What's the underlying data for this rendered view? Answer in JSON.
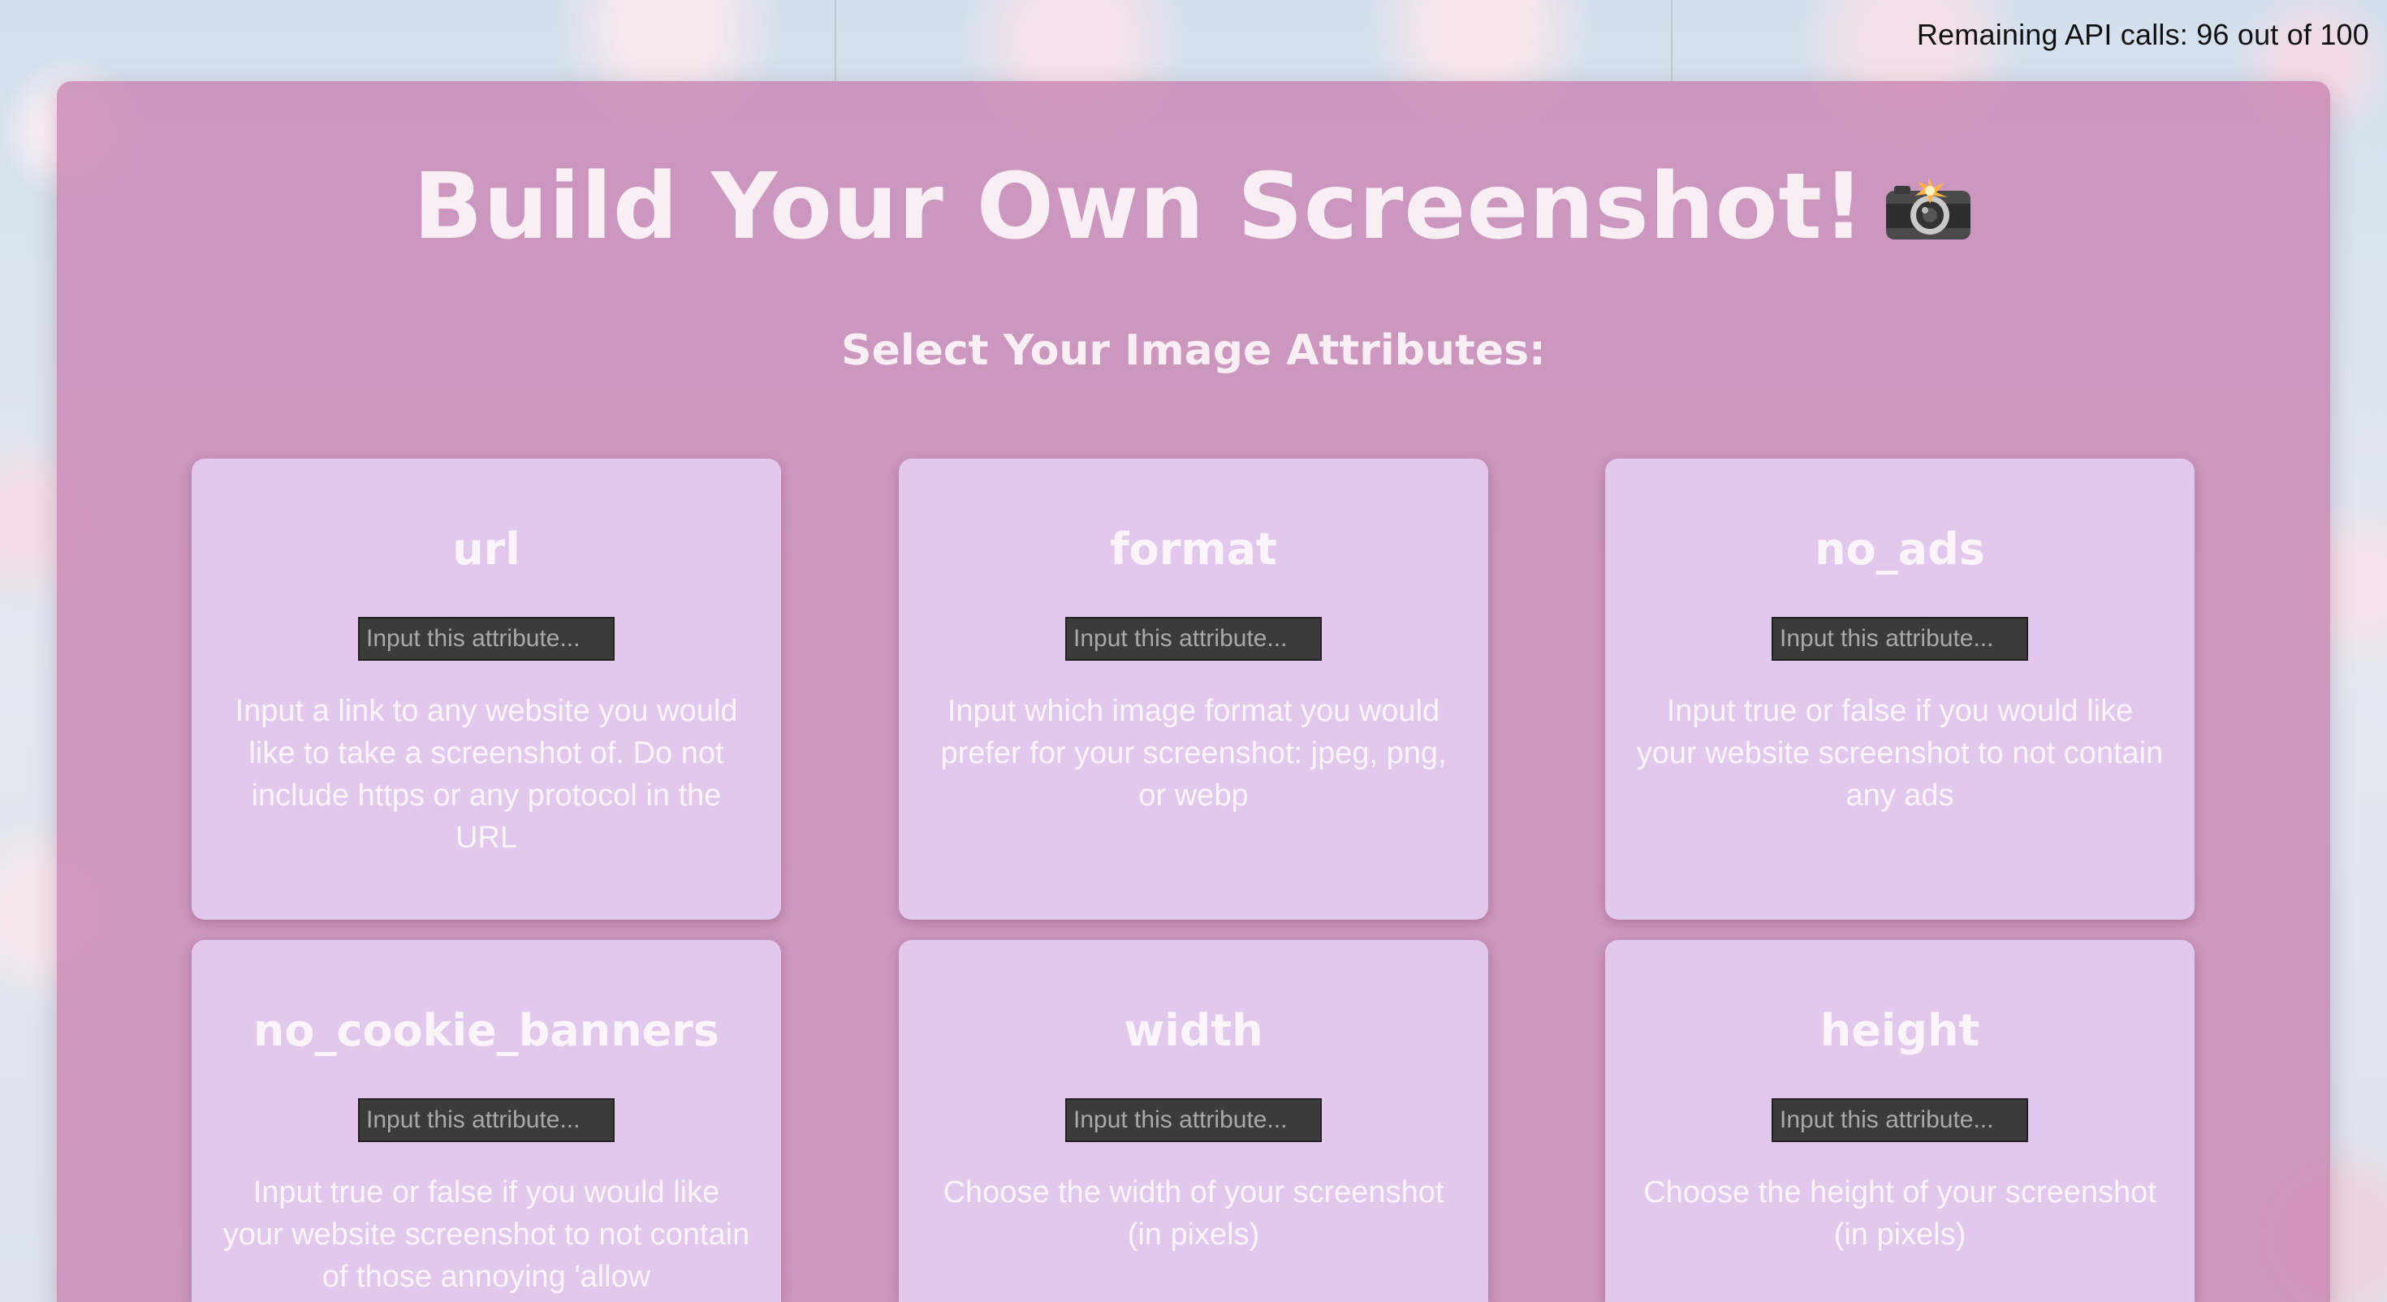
{
  "api_counter": "Remaining API calls: 96 out of 100",
  "title": "Build Your Own Screenshot!",
  "title_icon": "camera-flash-icon",
  "subtitle": "Select Your Image Attributes:",
  "input_placeholder": "Input this attribute...",
  "cards": [
    {
      "name": "url",
      "description": "Input a link to any website you would like to take a screenshot of. Do not include https or any protocol in the URL"
    },
    {
      "name": "format",
      "description": "Input which image format you would prefer for your screenshot: jpeg, png, or webp"
    },
    {
      "name": "no_ads",
      "description": "Input true or false if you would like your website screenshot to not contain any ads"
    },
    {
      "name": "no_cookie_banners",
      "description": "Input true or false if you would like your website screenshot to not contain of those annoying 'allow"
    },
    {
      "name": "width",
      "description": "Choose the width of your screenshot (in pixels)"
    },
    {
      "name": "height",
      "description": "Choose the height of your screenshot (in pixels)"
    }
  ]
}
